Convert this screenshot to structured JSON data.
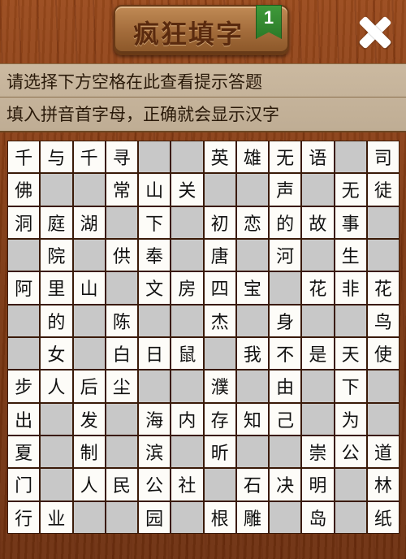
{
  "header": {
    "title": "疯狂填字",
    "level": "1",
    "close_icon": "close-x-icon"
  },
  "hints": {
    "line1": "请选择下方空格在此查看提示答题",
    "line2": "填入拼音首字母，正确就会显示汉字"
  },
  "colors": {
    "wood": "#7d3812",
    "hint_bg": "#c4b298",
    "cell_filled": "#fdfcf8",
    "cell_blank": "#c8c8c8",
    "level_flag": "#2b7a28"
  },
  "grid": {
    "rows": [
      [
        "千",
        "与",
        "千",
        "寻",
        "",
        "",
        "英",
        "雄",
        "无",
        "语",
        "",
        "司"
      ],
      [
        "佛",
        "",
        "",
        "常",
        "山",
        "关",
        "",
        "",
        "声",
        "",
        "无",
        "徒"
      ],
      [
        "洞",
        "庭",
        "湖",
        "",
        "下",
        "",
        "初",
        "恋",
        "的",
        "故",
        "事",
        ""
      ],
      [
        "",
        "院",
        "",
        "供",
        "奉",
        "",
        "唐",
        "",
        "河",
        "",
        "生",
        ""
      ],
      [
        "阿",
        "里",
        "山",
        "",
        "文",
        "房",
        "四",
        "宝",
        "",
        "花",
        "非",
        "花"
      ],
      [
        "",
        "的",
        "",
        "陈",
        "",
        "",
        "杰",
        "",
        "身",
        "",
        "",
        "鸟"
      ],
      [
        "",
        "女",
        "",
        "白",
        "日",
        "鼠",
        "",
        "我",
        "不",
        "是",
        "天",
        "使"
      ],
      [
        "步",
        "人",
        "后",
        "尘",
        "",
        "",
        "濮",
        "",
        "由",
        "",
        "下",
        ""
      ],
      [
        "出",
        "",
        "发",
        "",
        "海",
        "内",
        "存",
        "知",
        "己",
        "",
        "为",
        ""
      ],
      [
        "夏",
        "",
        "制",
        "",
        "滨",
        "",
        "昕",
        "",
        "",
        "崇",
        "公",
        "道"
      ],
      [
        "门",
        "",
        "人",
        "民",
        "公",
        "社",
        "",
        "石",
        "决",
        "明",
        "",
        "林"
      ],
      [
        "行",
        "业",
        "",
        "",
        "园",
        "",
        "根",
        "雕",
        "",
        "岛",
        "",
        "纸"
      ]
    ]
  }
}
